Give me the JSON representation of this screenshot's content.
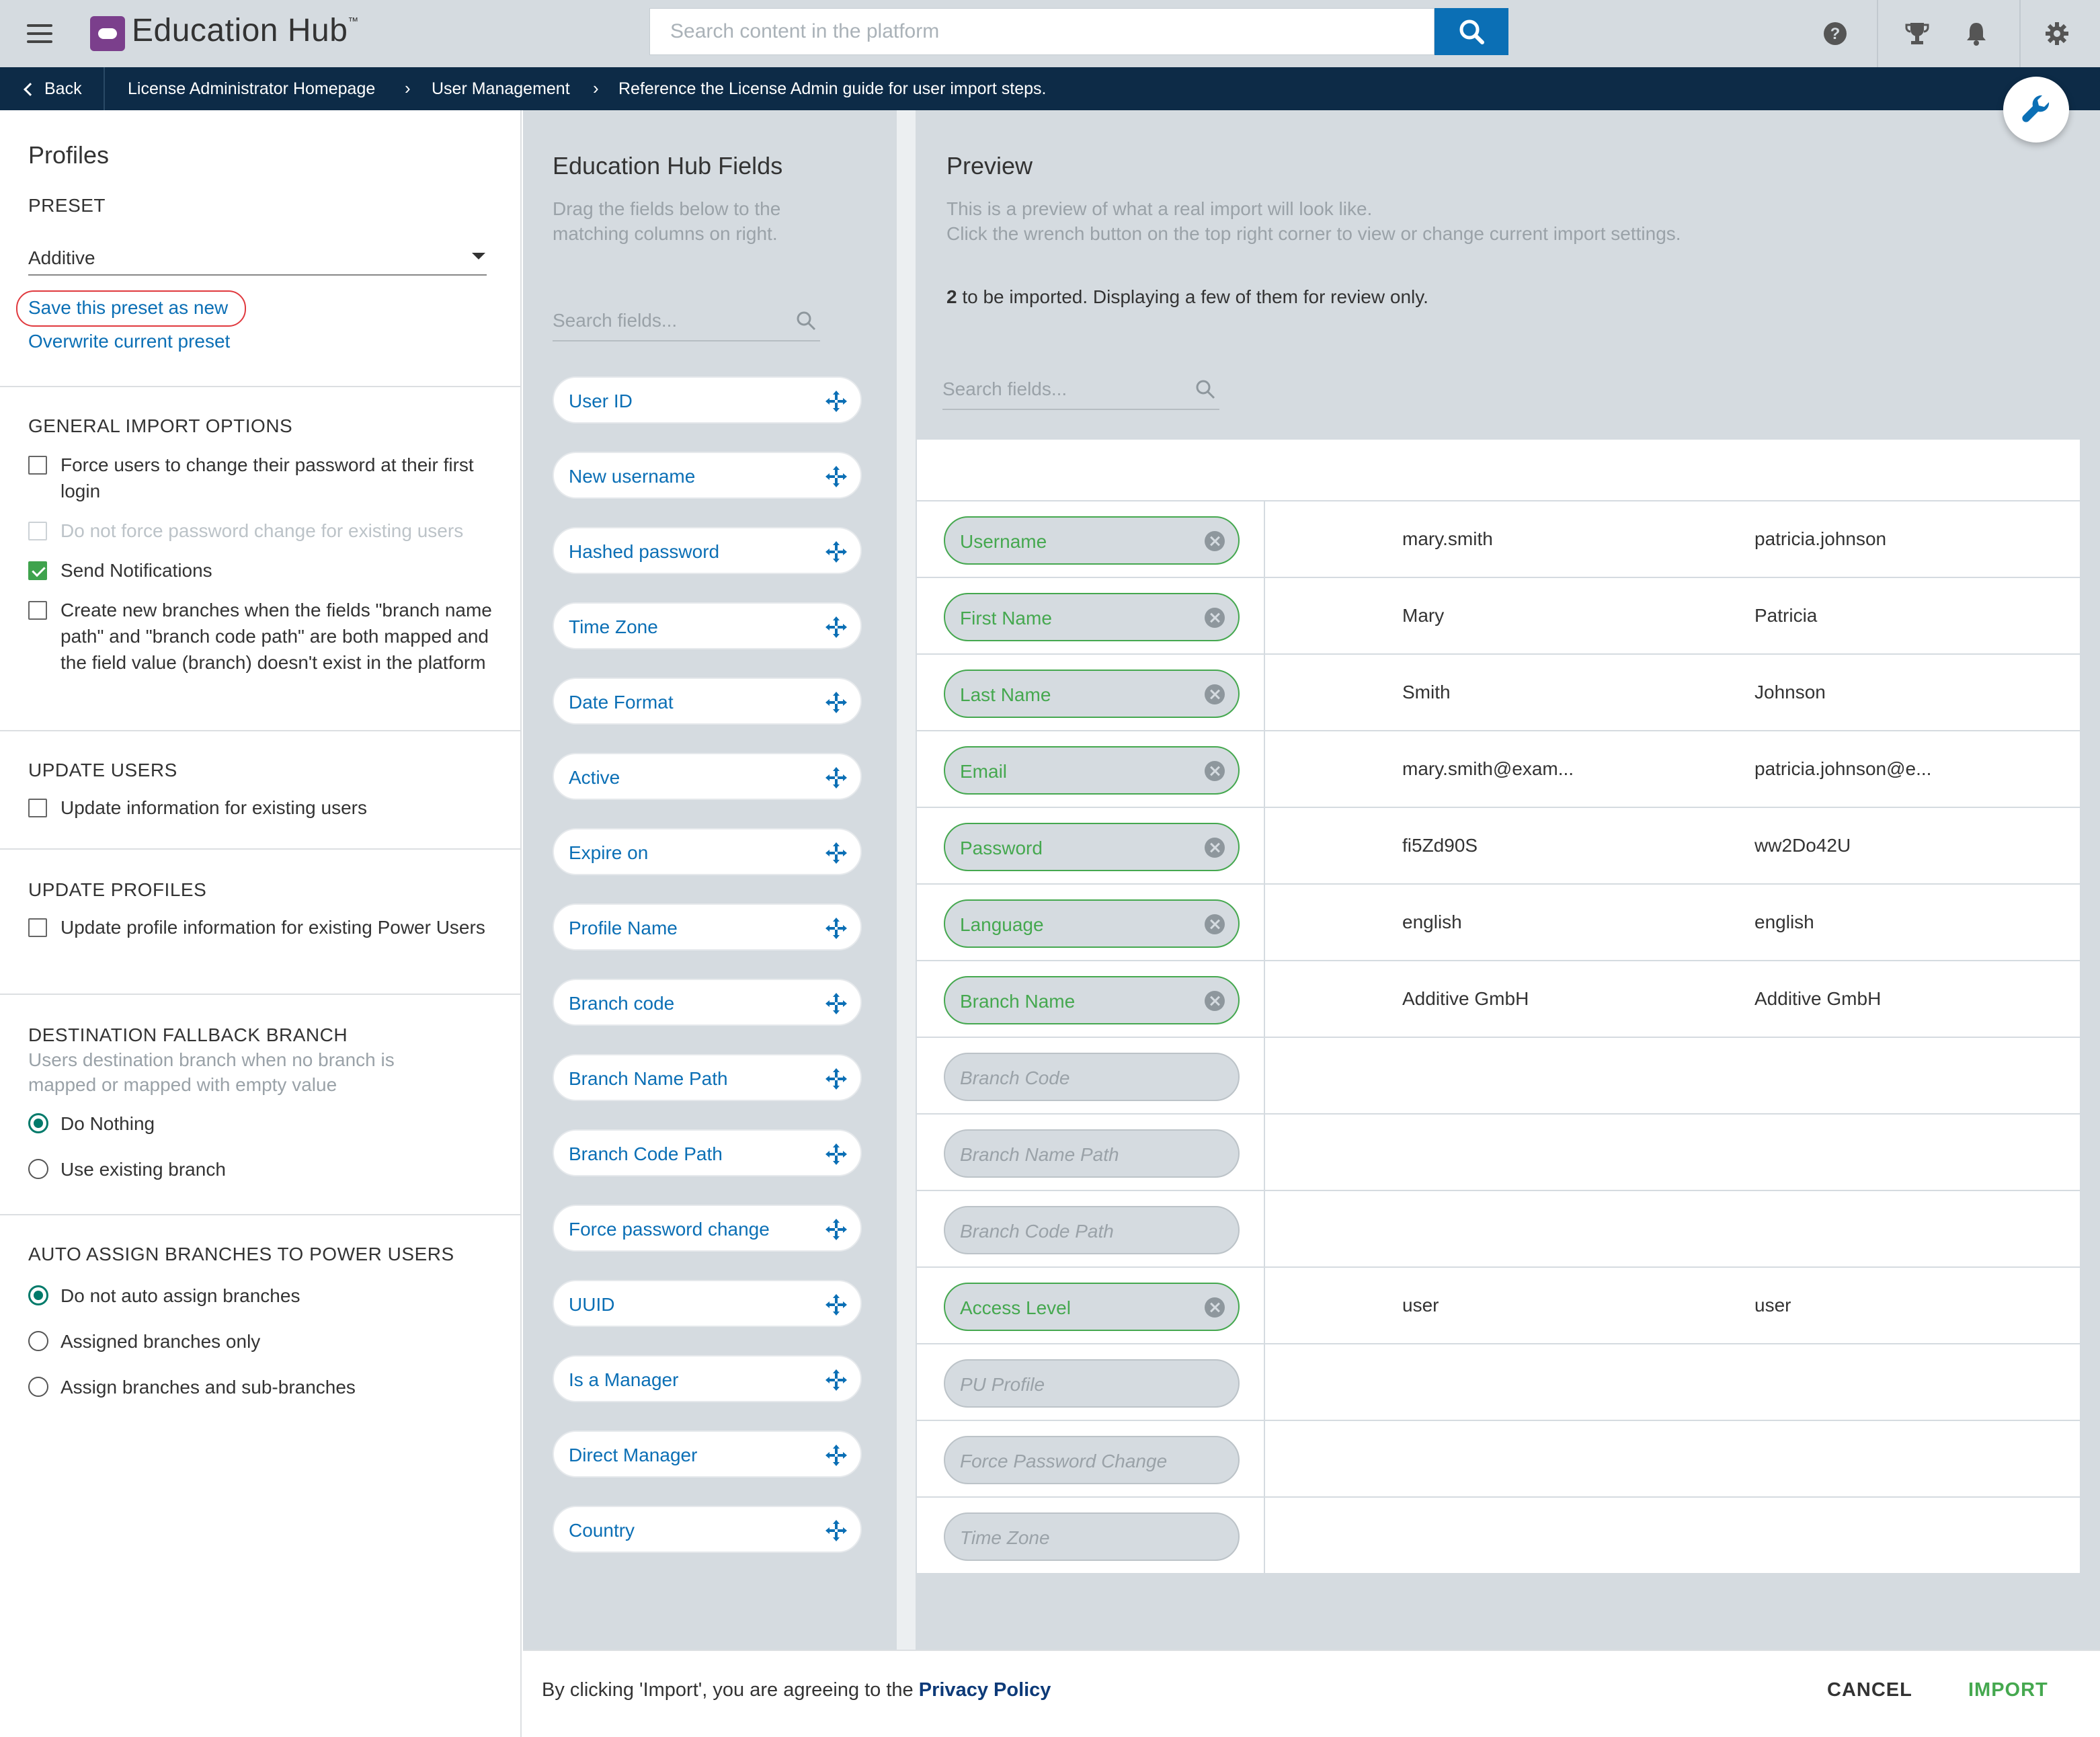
{
  "app": {
    "title": "Education Hub",
    "trademark": "™"
  },
  "search": {
    "placeholder": "Search content in the platform"
  },
  "top_icons": [
    "help-icon",
    "trophy-icon",
    "bell-icon",
    "gear-icon"
  ],
  "breadcrumb": {
    "back": "Back",
    "items": [
      "License Administrator Homepage",
      "User Management",
      "Reference the License Admin guide for user import steps."
    ]
  },
  "left": {
    "title": "Profiles",
    "preset_label": "PRESET",
    "preset_value": "Additive",
    "save_new": "Save this preset as new",
    "overwrite": "Overwrite current preset",
    "general": {
      "title": "GENERAL IMPORT OPTIONS",
      "opt1": "Force users to change their password at their first login",
      "opt2": "Do not force password change for existing users",
      "opt3": "Send Notifications",
      "opt4": "Create new branches when the fields \"branch name path\" and \"branch code path\" are both mapped and the field value (branch) doesn't exist in the platform"
    },
    "update_users": {
      "title": "UPDATE USERS",
      "opt": "Update information for existing users"
    },
    "update_profiles": {
      "title": "UPDATE PROFILES",
      "opt": "Update profile information for existing Power Users"
    },
    "fallback": {
      "title": "DESTINATION FALLBACK BRANCH",
      "desc": "Users destination branch when no branch is mapped or mapped with empty value",
      "opt1": "Do Nothing",
      "opt2": "Use existing branch"
    },
    "auto_assign": {
      "title": "AUTO ASSIGN BRANCHES TO POWER USERS",
      "opt1": "Do not auto assign branches",
      "opt2": "Assigned branches only",
      "opt3": "Assign branches and sub-branches"
    }
  },
  "fields": {
    "title": "Education Hub Fields",
    "subtitle": "Drag the fields below to the matching columns on right.",
    "search_placeholder": "Search fields...",
    "items": [
      "User ID",
      "New username",
      "Hashed password",
      "Time Zone",
      "Date Format",
      "Active",
      "Expire on",
      "Profile Name",
      "Branch code",
      "Branch Name Path",
      "Branch Code Path",
      "Force password change",
      "UUID",
      "Is a Manager",
      "Direct Manager",
      "Country"
    ]
  },
  "preview": {
    "title": "Preview",
    "subtitle_line1": "This is a preview of what a real import will look like.",
    "subtitle_line2": "Click the wrench button on the top right corner to view or change current import settings.",
    "count_number": "2",
    "count_text": " to be imported. Displaying a few of them for review only.",
    "search_placeholder": "Search fields...",
    "rows": [
      {
        "field": "Username",
        "mapped": true,
        "v1": "mary.smith",
        "v2": "patricia.johnson"
      },
      {
        "field": "First Name",
        "mapped": true,
        "v1": "Mary",
        "v2": "Patricia"
      },
      {
        "field": "Last Name",
        "mapped": true,
        "v1": "Smith",
        "v2": "Johnson"
      },
      {
        "field": "Email",
        "mapped": true,
        "v1": "mary.smith@exam...",
        "v2": "patricia.johnson@e..."
      },
      {
        "field": "Password",
        "mapped": true,
        "v1": "fi5Zd90S",
        "v2": "ww2Do42U"
      },
      {
        "field": "Language",
        "mapped": true,
        "v1": "english",
        "v2": "english"
      },
      {
        "field": "Branch Name",
        "mapped": true,
        "v1": "Additive GmbH",
        "v2": "Additive GmbH"
      },
      {
        "field": "Branch Code",
        "mapped": false,
        "v1": "",
        "v2": ""
      },
      {
        "field": "Branch Name Path",
        "mapped": false,
        "v1": "",
        "v2": ""
      },
      {
        "field": "Branch Code Path",
        "mapped": false,
        "v1": "",
        "v2": ""
      },
      {
        "field": "Access Level",
        "mapped": true,
        "v1": "user",
        "v2": "user"
      },
      {
        "field": "PU Profile",
        "mapped": false,
        "v1": "",
        "v2": ""
      },
      {
        "field": "Force Password Change",
        "mapped": false,
        "v1": "",
        "v2": ""
      },
      {
        "field": "Time Zone",
        "mapped": false,
        "v1": "",
        "v2": ""
      }
    ]
  },
  "footer": {
    "agree_text": "By clicking 'Import', you are agreeing to the ",
    "privacy": "Privacy Policy",
    "cancel": "CANCEL",
    "import": "IMPORT"
  },
  "colors": {
    "accent": "#0b6fb5",
    "mapped": "#45a84f",
    "nav": "#0d2b47",
    "panel": "#d5dbe0",
    "brand": "#7b3f8c"
  }
}
